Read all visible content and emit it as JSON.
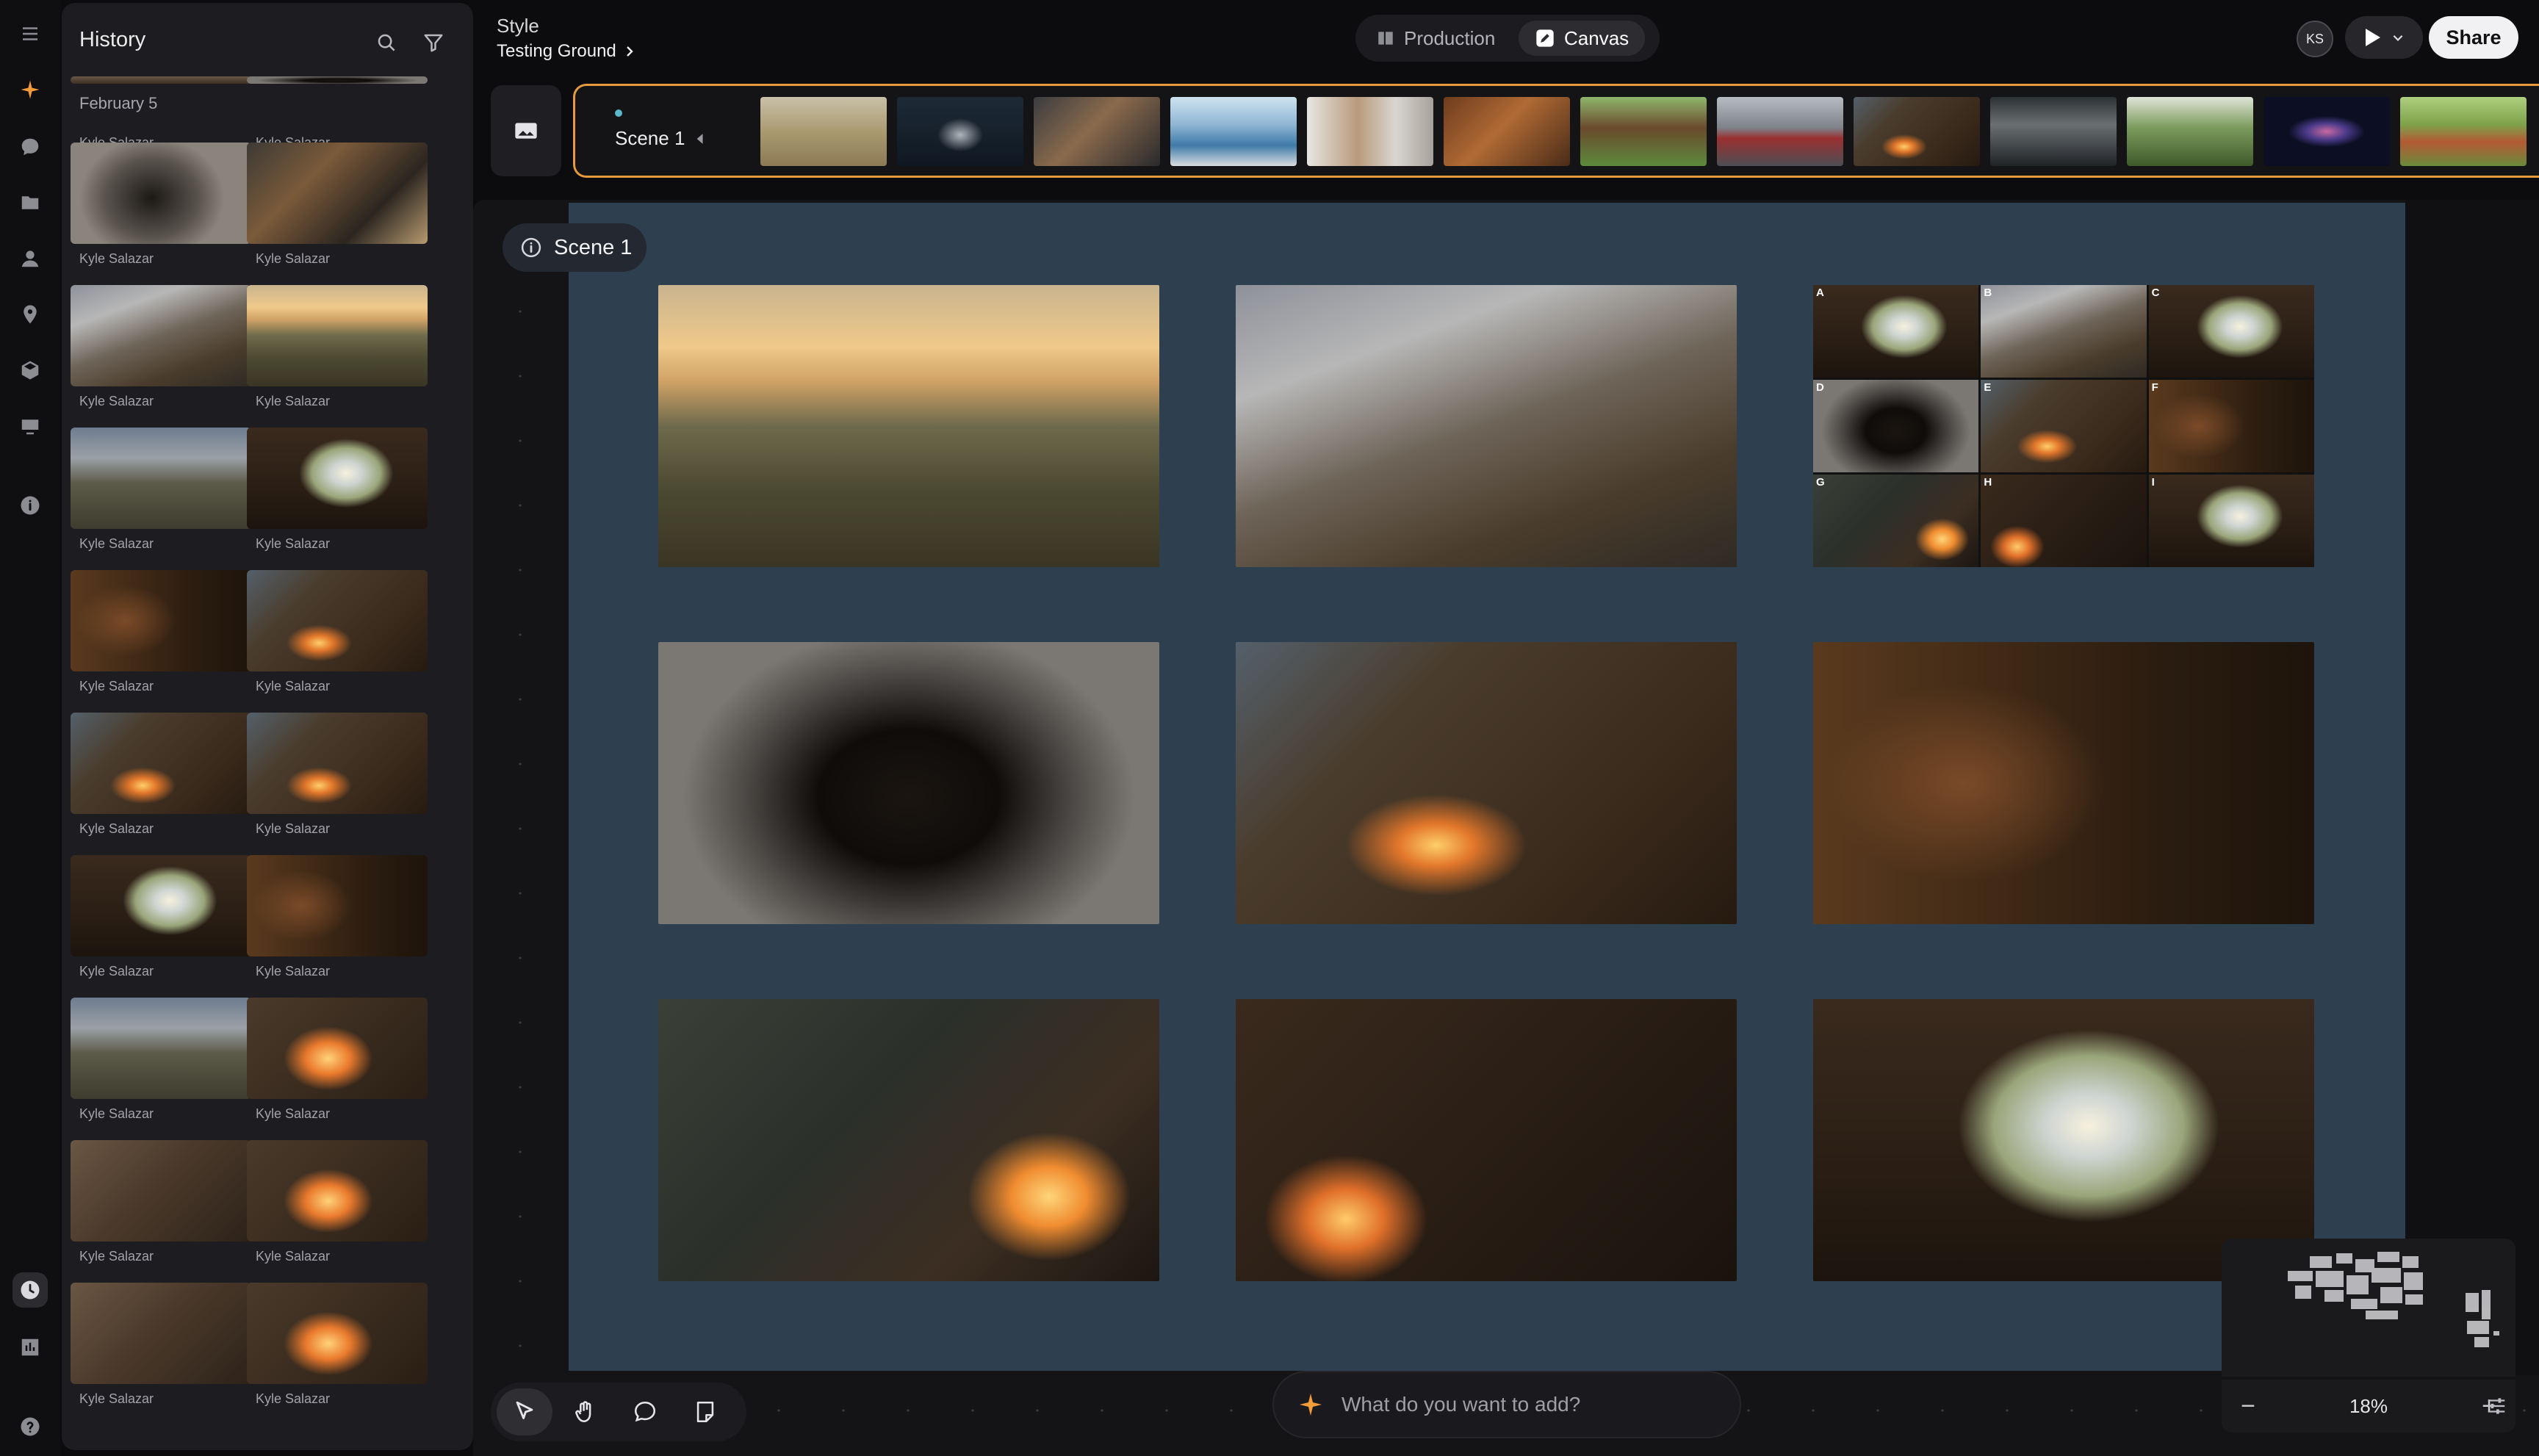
{
  "history": {
    "title": "History",
    "date_group": "February 5",
    "items": [
      {
        "author": "Kyle Salazar",
        "scene": "cave-fire"
      },
      {
        "author": "Kyle Salazar",
        "scene": "dark-cave"
      },
      {
        "author": "Kyle Salazar",
        "scene": "cave-man"
      },
      {
        "author": "Kyle Salazar",
        "scene": "grid"
      },
      {
        "author": "Kyle Salazar",
        "scene": "firewood"
      },
      {
        "author": "Kyle Salazar",
        "scene": "sunset"
      },
      {
        "author": "Kyle Salazar",
        "scene": "plains"
      },
      {
        "author": "Kyle Salazar",
        "scene": "cave-exit"
      },
      {
        "author": "Kyle Salazar",
        "scene": "painting"
      },
      {
        "author": "Kyle Salazar",
        "scene": "fire-cave"
      },
      {
        "author": "Kyle Salazar",
        "scene": "fire-cave"
      },
      {
        "author": "Kyle Salazar",
        "scene": "fire-cave"
      },
      {
        "author": "Kyle Salazar",
        "scene": "cave-exit"
      },
      {
        "author": "Kyle Salazar",
        "scene": "painting"
      },
      {
        "author": "Kyle Salazar",
        "scene": "plains"
      },
      {
        "author": "Kyle Salazar",
        "scene": "fire-close"
      },
      {
        "author": "Kyle Salazar",
        "scene": "portrait"
      },
      {
        "author": "Kyle Salazar",
        "scene": "fire-close"
      },
      {
        "author": "Kyle Salazar",
        "scene": "portrait"
      },
      {
        "author": "Kyle Salazar",
        "scene": "fire-close"
      }
    ]
  },
  "topbar": {
    "style_label": "Style",
    "project_name": "Testing Ground",
    "view_production": "Production",
    "view_canvas": "Canvas",
    "avatar_initials": "KS",
    "share_label": "Share"
  },
  "scene_strip": {
    "scene_label": "Scene 1",
    "thumbnails": [
      "puppy",
      "night-forest",
      "monkey",
      "pool",
      "lab",
      "orangutan",
      "bear",
      "knight",
      "fire-cave",
      "crowd",
      "park",
      "nebula",
      "tractor"
    ]
  },
  "canvas": {
    "scene_chip": "Scene 1",
    "frames": [
      {
        "scene": "sunset"
      },
      {
        "scene": "firewood"
      },
      {
        "scene": "grid",
        "labels": [
          "A",
          "B",
          "C",
          "D",
          "E",
          "F",
          "G",
          "H",
          "I"
        ]
      },
      {
        "scene": "dark-cave"
      },
      {
        "scene": "fire-cave"
      },
      {
        "scene": "painting"
      },
      {
        "scene": "roast"
      },
      {
        "scene": "sleeping"
      },
      {
        "scene": "cave-exit"
      }
    ]
  },
  "prompt": {
    "placeholder": "What do you want to add?"
  },
  "zoom": {
    "level": "18%",
    "minus": "−",
    "plus": "+"
  },
  "colors": {
    "accent": "#e59a3b",
    "scene_frame": "#2e3f4f",
    "share_bg": "#f1f1f3"
  }
}
